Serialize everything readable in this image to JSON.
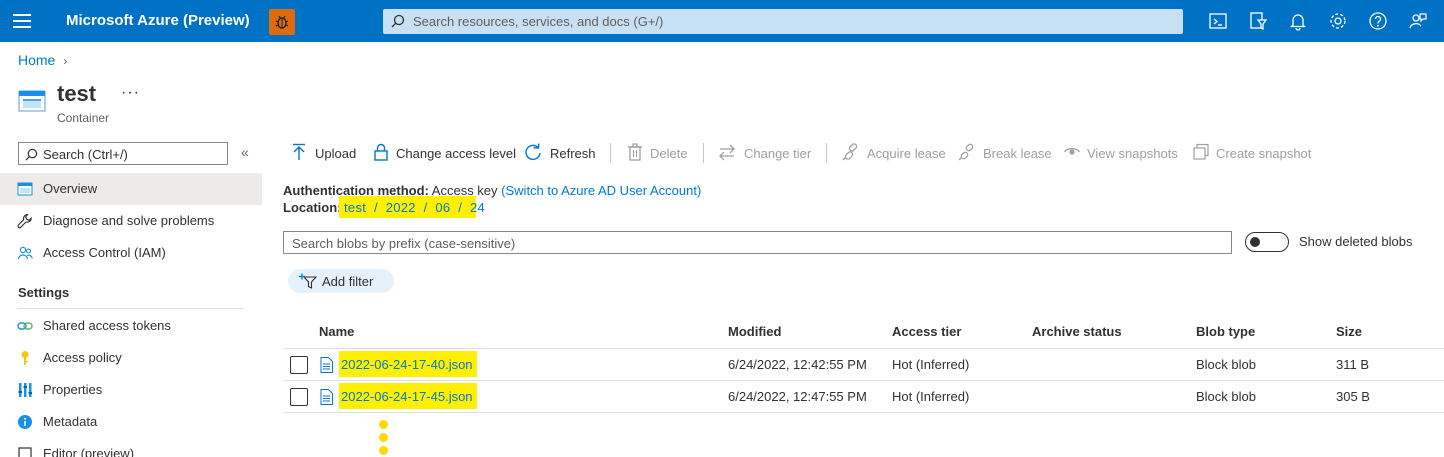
{
  "topbar": {
    "brand": "Microsoft Azure (Preview)",
    "search_placeholder": "Search resources, services, and docs (G+/)",
    "icons": [
      "cloud-shell-icon",
      "directory-filter-icon",
      "notifications-icon",
      "settings-icon",
      "help-icon",
      "feedback-icon"
    ],
    "accent": "#0072c6"
  },
  "breadcrumb": {
    "home": "Home"
  },
  "header": {
    "title": "test",
    "more": "···",
    "subtitle": "Container"
  },
  "sidebar": {
    "search_placeholder": "Search (Ctrl+/)",
    "collapse": "«",
    "items": [
      {
        "label": "Overview",
        "icon": "overview-icon"
      },
      {
        "label": "Diagnose and solve problems",
        "icon": "wrench-icon"
      },
      {
        "label": "Access Control (IAM)",
        "icon": "people-icon"
      }
    ],
    "settings_header": "Settings",
    "settings_items": [
      {
        "label": "Shared access tokens",
        "icon": "link-icon"
      },
      {
        "label": "Access policy",
        "icon": "key-icon"
      },
      {
        "label": "Properties",
        "icon": "properties-icon"
      },
      {
        "label": "Metadata",
        "icon": "info-icon"
      },
      {
        "label": "Editor (preview)",
        "icon": "editor-icon"
      }
    ]
  },
  "toolbar": {
    "upload": "Upload",
    "change_access": "Change access level",
    "refresh": "Refresh",
    "delete": "Delete",
    "change_tier": "Change tier",
    "acquire_lease": "Acquire lease",
    "break_lease": "Break lease",
    "view_snapshots": "View snapshots",
    "create_snapshot": "Create snapshot"
  },
  "info": {
    "auth_label": "Authentication method:",
    "auth_value": "Access key",
    "auth_link": "(Switch to Azure AD User Account)",
    "location_label": "Location:",
    "location_value": "test  /  2022  /  06  /  24"
  },
  "blob_search": {
    "placeholder": "Search blobs by prefix (case-sensitive)"
  },
  "toggle": {
    "label": "Show deleted blobs",
    "on": false
  },
  "filter": {
    "label": "Add filter"
  },
  "table": {
    "headers": [
      "Name",
      "Modified",
      "Access tier",
      "Archive status",
      "Blob type",
      "Size"
    ],
    "rows": [
      {
        "name": "2022-06-24-17-40.json",
        "modified": "6/24/2022, 12:42:55 PM",
        "tier": "Hot (Inferred)",
        "archive": "",
        "type": "Block blob",
        "size": "311 B"
      },
      {
        "name": "2022-06-24-17-45.json",
        "modified": "6/24/2022, 12:47:55 PM",
        "tier": "Hot (Inferred)",
        "archive": "",
        "type": "Block blob",
        "size": "305 B"
      }
    ]
  },
  "highlight_color": "#ffef00"
}
